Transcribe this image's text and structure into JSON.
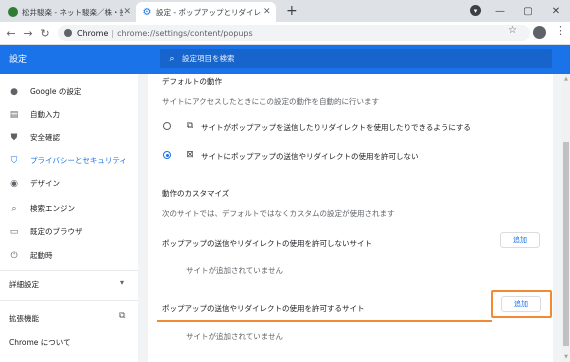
{
  "browser": {
    "tabs": [
      {
        "title": "松井駿楽 - ネット駿楽／株・投信・…",
        "icon": "site-favicon",
        "active": false
      },
      {
        "title": "設定 - ポップアップとリダイレクト",
        "icon": "settings-gear-icon",
        "active": true
      }
    ],
    "new_tab": "+",
    "omnibox": {
      "origin": "Chrome",
      "separator": "|",
      "url": "chrome://settings/content/popups"
    }
  },
  "settings": {
    "title": "設定",
    "search_placeholder": "設定項目を検索",
    "sidebar": {
      "items": [
        {
          "label": "Google の設定",
          "icon": "person-icon"
        },
        {
          "label": "自動入力",
          "icon": "clipboard-icon"
        },
        {
          "label": "安全確認",
          "icon": "shield-check-icon"
        },
        {
          "label": "プライバシーとセキュリティ",
          "icon": "shield-icon",
          "active": true
        },
        {
          "label": "デザイン",
          "icon": "palette-icon"
        },
        {
          "label": "検索エンジン",
          "icon": "search-icon"
        },
        {
          "label": "既定のブラウザ",
          "icon": "browser-icon"
        },
        {
          "label": "起動時",
          "icon": "power-icon"
        }
      ],
      "advanced": "詳細設定",
      "extensions": "拡張機能",
      "about": "Chrome について"
    },
    "content": {
      "default_behavior_title": "デフォルトの動作",
      "default_behavior_desc": "サイトにアクセスしたときにこの設定の動作を自動的に行います",
      "options": [
        {
          "label": "サイトがポップアップを送信したりリダイレクトを使用したりできるようにする",
          "icon": "external-link-icon",
          "checked": false
        },
        {
          "label": "サイトにポップアップの送信やリダイレクトの使用を許可しない",
          "icon": "popup-blocked-icon",
          "checked": true
        }
      ],
      "custom_title": "動作のカスタマイズ",
      "custom_desc": "次のサイトでは、デフォルトではなくカスタムの設定が使用されます",
      "block_section": {
        "label": "ポップアップの送信やリダイレクトの使用を許可しないサイト",
        "add": "追加",
        "empty": "サイトが追加されていません"
      },
      "allow_section": {
        "label": "ポップアップの送信やリダイレクトの使用を許可するサイト",
        "add": "追加",
        "empty": "サイトが追加されていません"
      }
    },
    "highlight_color": "#f08a36",
    "accent_color": "#1a73e8"
  }
}
